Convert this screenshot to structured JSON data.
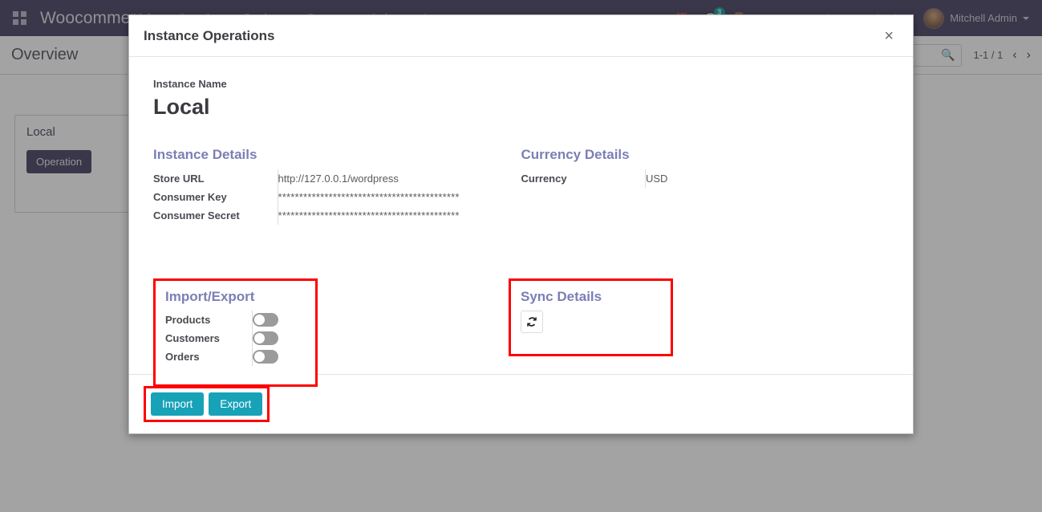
{
  "navbar": {
    "apps_icon": "apps-grid-icon",
    "brand": "Woocommerce",
    "menu": [
      {
        "label": "Overview"
      },
      {
        "label": "Products"
      },
      {
        "label": "Partners"
      },
      {
        "label": "Orders"
      },
      {
        "label": "Instance"
      }
    ],
    "clock_icon": "clock-icon",
    "messages_icon": "chat-bubble-icon",
    "messages_count": "3",
    "activities_icon": "activity-clock-icon",
    "company": "My Company (San Francisco)",
    "user_name": "Mitchell Admin",
    "avatar": "user-avatar"
  },
  "control_panel": {
    "breadcrumb": "Overview",
    "search_placeholder": "",
    "search_icon": "search-icon",
    "pager_text": "1-1 / 1",
    "prev_icon": "chevron-left-icon",
    "next_icon": "chevron-right-icon"
  },
  "background": {
    "card_title": "Local",
    "card_button": "Operation"
  },
  "modal": {
    "title": "Instance Operations",
    "close_icon": "close-icon",
    "instance_name_label": "Instance Name",
    "instance_name_value": "Local",
    "instance_details": {
      "group_title": "Instance Details",
      "rows": [
        {
          "label": "Store URL",
          "value": "http://127.0.0.1/wordpress"
        },
        {
          "label": "Consumer Key",
          "value": "*******************************************"
        },
        {
          "label": "Consumer Secret",
          "value": "*******************************************"
        }
      ]
    },
    "currency_details": {
      "group_title": "Currency Details",
      "rows": [
        {
          "label": "Currency",
          "value": "USD"
        }
      ]
    },
    "import_export": {
      "group_title": "Import/Export",
      "toggles": [
        {
          "label": "Products",
          "on": false
        },
        {
          "label": "Customers",
          "on": false
        },
        {
          "label": "Orders",
          "on": false
        }
      ]
    },
    "sync_details": {
      "group_title": "Sync Details",
      "sync_icon": "refresh-sync-icon"
    },
    "footer": {
      "import_label": "Import",
      "export_label": "Export"
    }
  },
  "colors": {
    "navbar_bg": "#3f3b5b",
    "group_title": "#7b7fb5",
    "highlight": "#fe0000",
    "button_teal": "#17a2b8",
    "badge_teal": "#00a09d"
  }
}
